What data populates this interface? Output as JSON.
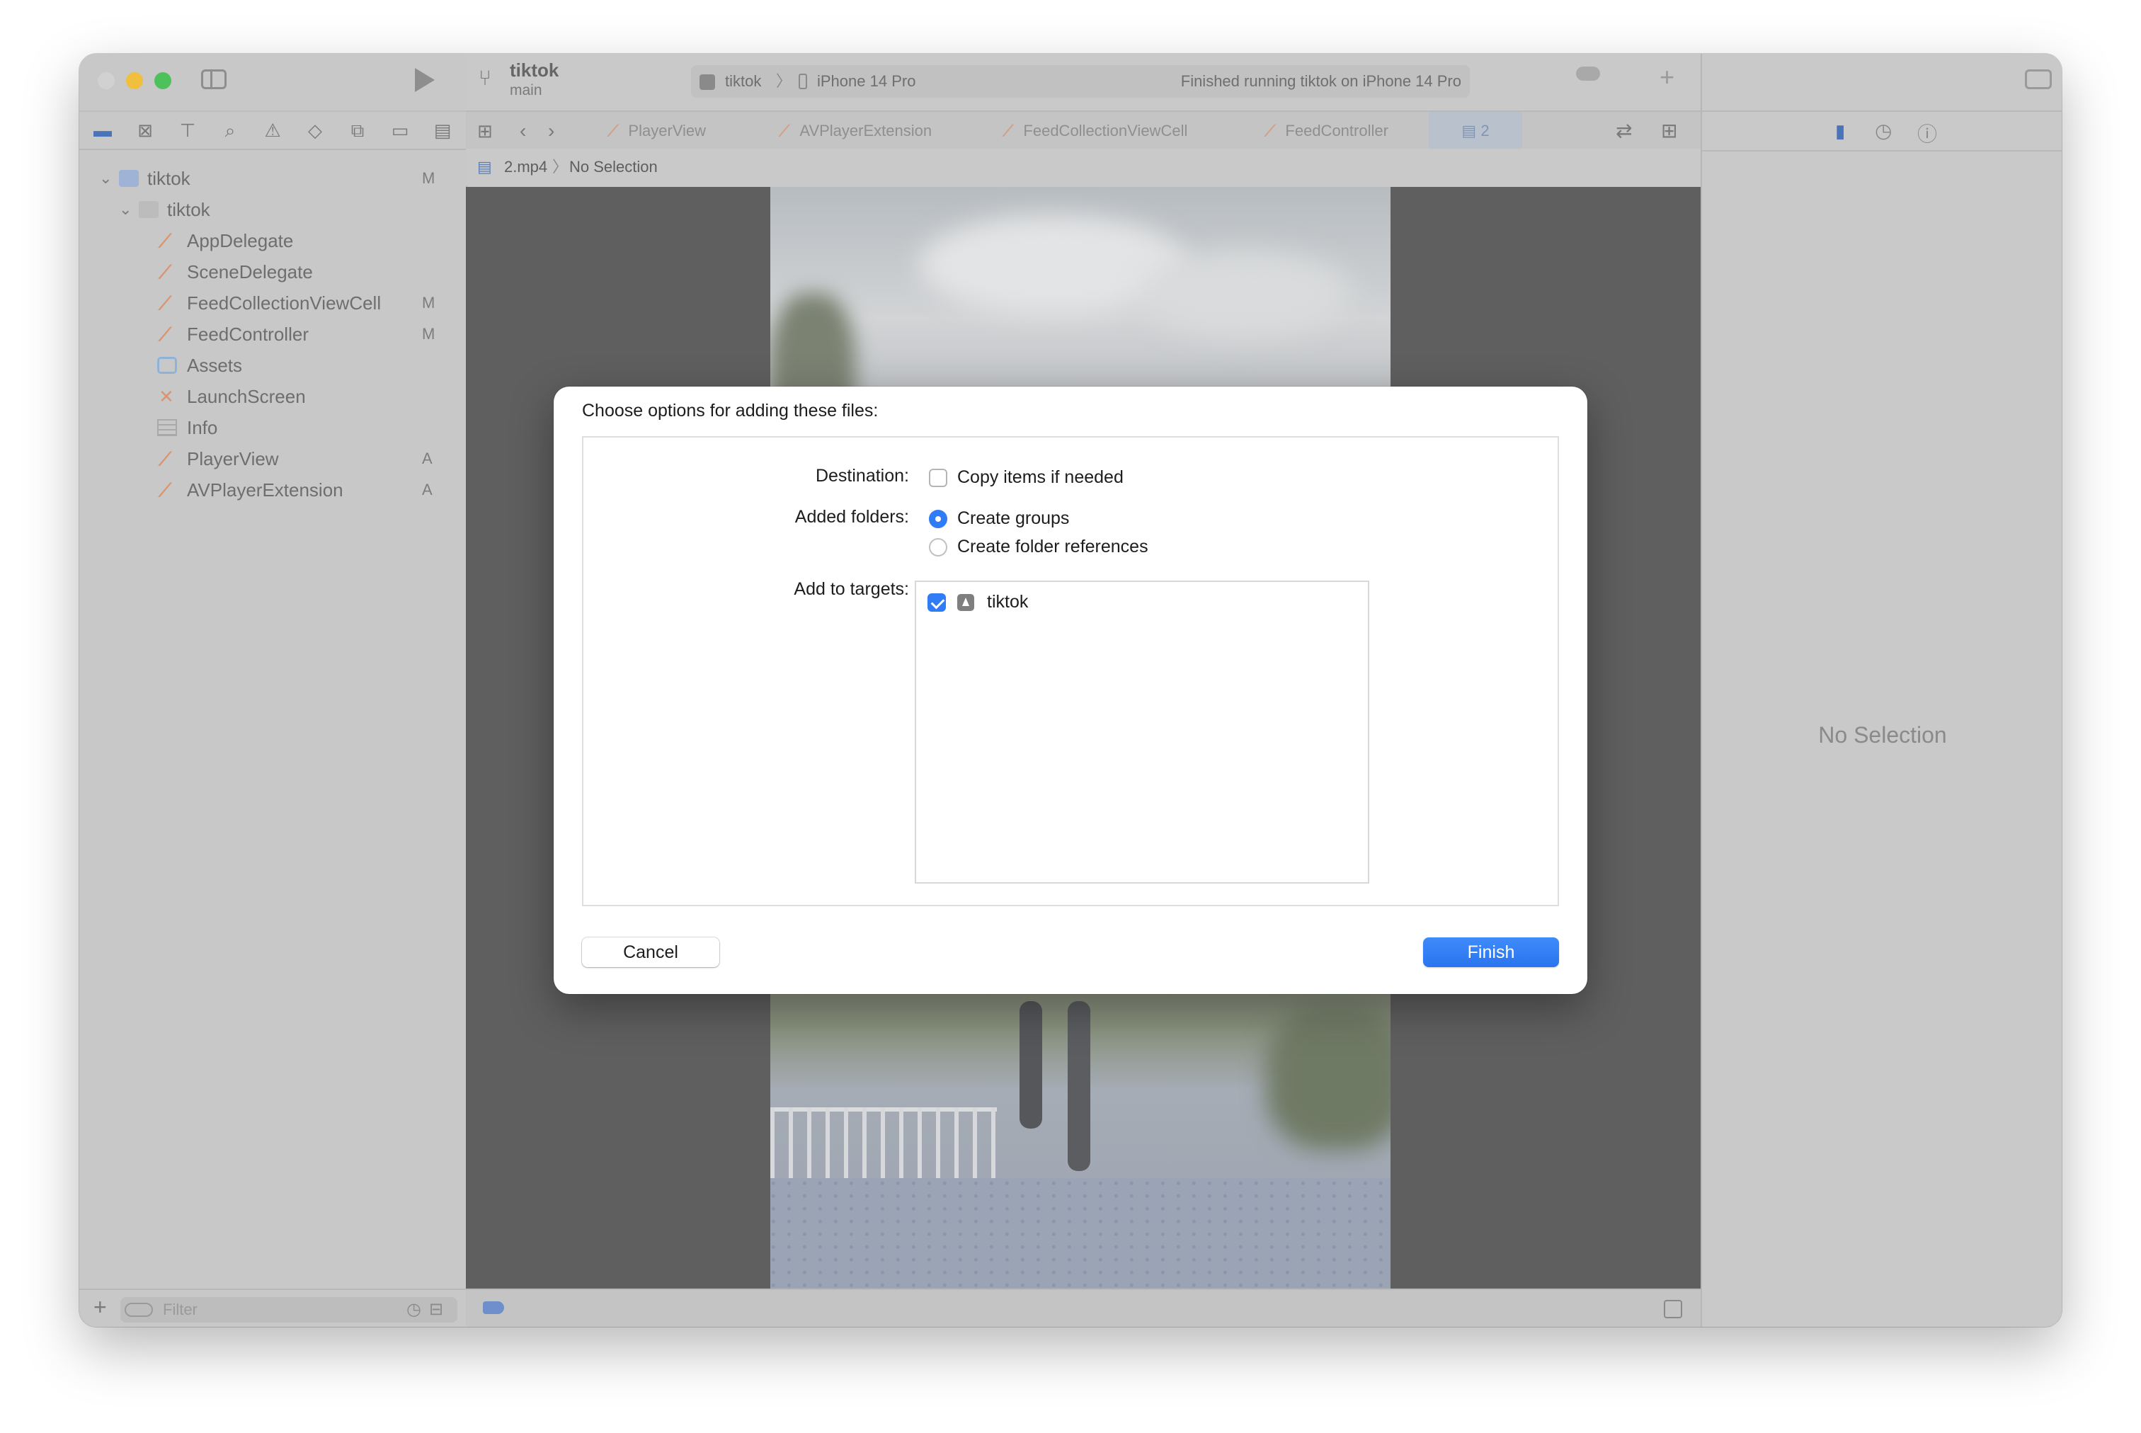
{
  "window": {
    "traffic_colors": [
      "#d1d1d1",
      "#f0bf3d",
      "#4ec25a"
    ]
  },
  "toolbar": {
    "project_name": "tiktok",
    "branch": "main",
    "scheme_target": "tiktok",
    "device": "iPhone 14 Pro",
    "status": "Finished running tiktok on iPhone 14 Pro",
    "add_symbol": "+"
  },
  "navigator": {
    "items": [
      {
        "label": "tiktok",
        "badge": "M",
        "kind": "project"
      },
      {
        "label": "tiktok",
        "badge": "",
        "kind": "folder"
      },
      {
        "label": "AppDelegate",
        "badge": "",
        "kind": "swift"
      },
      {
        "label": "SceneDelegate",
        "badge": "",
        "kind": "swift"
      },
      {
        "label": "FeedCollectionViewCell",
        "badge": "M",
        "kind": "swift"
      },
      {
        "label": "FeedController",
        "badge": "M",
        "kind": "swift"
      },
      {
        "label": "Assets",
        "badge": "",
        "kind": "assets"
      },
      {
        "label": "LaunchScreen",
        "badge": "",
        "kind": "storyboard"
      },
      {
        "label": "Info",
        "badge": "",
        "kind": "plist"
      },
      {
        "label": "PlayerView",
        "badge": "A",
        "kind": "swift"
      },
      {
        "label": "AVPlayerExtension",
        "badge": "A",
        "kind": "swift"
      }
    ],
    "filter_placeholder": "Filter"
  },
  "editor_tabs": {
    "tabs": [
      "PlayerView",
      "AVPlayerExtension",
      "FeedCollectionViewCell",
      "FeedController"
    ],
    "active_tab": "2"
  },
  "jumpbar": {
    "file": "2.mp4",
    "selection": "No Selection"
  },
  "inspector": {
    "empty_label": "No Selection"
  },
  "dialog": {
    "title": "Choose options for adding these files:",
    "destination_label": "Destination:",
    "copy_items_label": "Copy items if needed",
    "copy_items_checked": false,
    "added_folders_label": "Added folders:",
    "folder_options": [
      "Create groups",
      "Create folder references"
    ],
    "folder_selected": "Create groups",
    "targets_label": "Add to targets:",
    "targets": [
      {
        "name": "tiktok",
        "checked": true
      }
    ],
    "cancel_label": "Cancel",
    "finish_label": "Finish"
  },
  "colors": {
    "accent": "#2f7cf6",
    "swift_icon": "#d89572"
  }
}
